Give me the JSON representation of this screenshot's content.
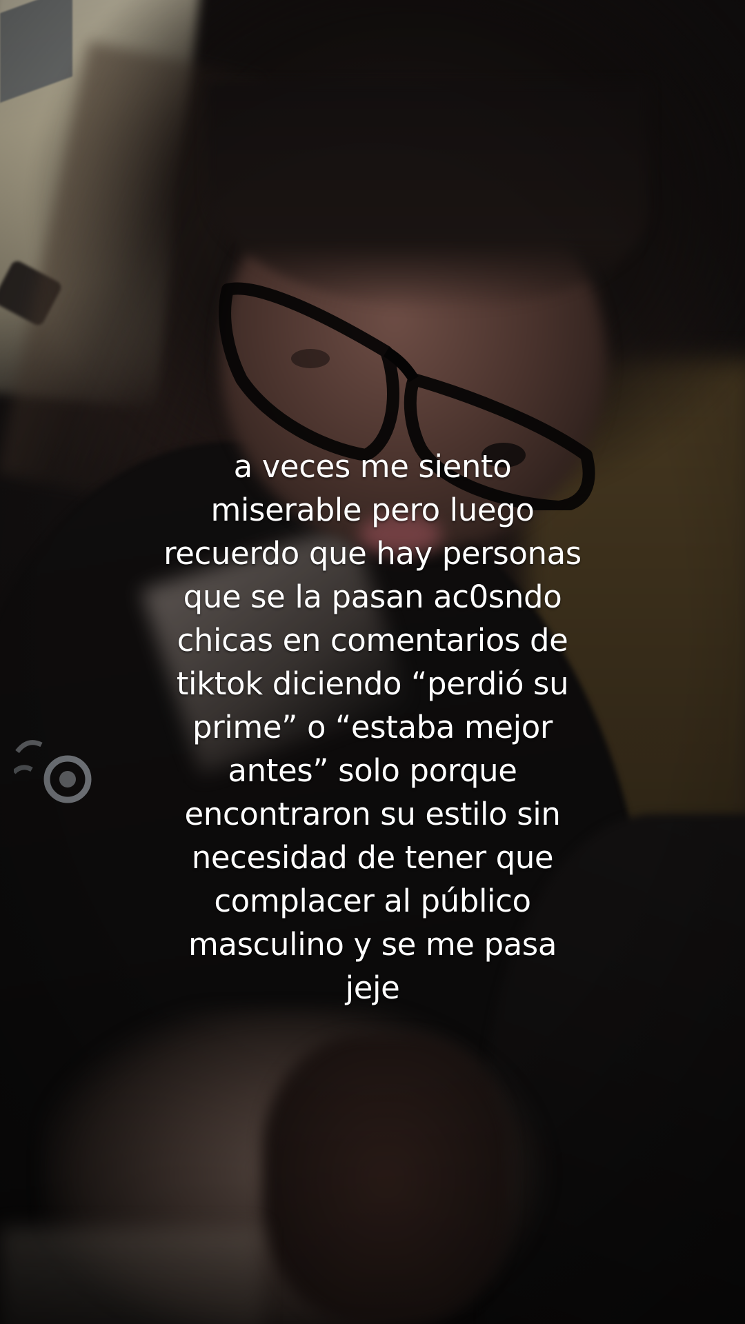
{
  "caption": {
    "lines": [
      "a veces me siento",
      "miserable pero luego",
      "recuerdo que hay personas",
      "que se la pasan ac0sndo",
      "chicas en comentarios de",
      "tiktok diciendo “perdió su",
      "prime” o “estaba mejor",
      "antes” solo porque",
      "encontraron su estilo sin",
      "necesidad de tener que",
      "complacer al público",
      "masculino y se me pasa",
      "jeje"
    ]
  },
  "colors": {
    "caption_text": "#ffffff",
    "background_dark": "#0b0a0a",
    "wall_warm": "#4a3b22",
    "skin": "#6d4d45"
  },
  "icons": {
    "jacket_logo": "jacket-logo-icon",
    "glasses": "glasses-icon"
  }
}
